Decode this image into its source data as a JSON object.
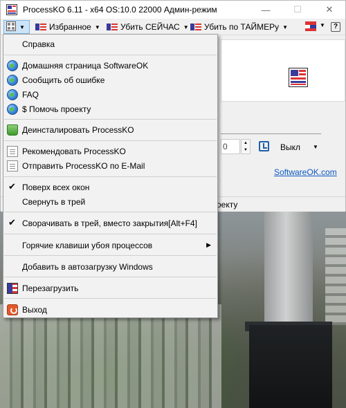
{
  "window": {
    "title": "ProcessKO 6.11 - x64   OS:10.0 22000 Админ-режим",
    "minimize_glyph": "—",
    "maximize_glyph": "☐",
    "close_glyph": "✕"
  },
  "toolbar": {
    "favorites": "Избранное",
    "kill_now": "Убить СЕЙЧАС",
    "kill_timer": "Убить по ТАЙМЕРу",
    "help_glyph": "?",
    "arrow_glyph": "▼"
  },
  "menu": {
    "items": [
      {
        "label": "Справка",
        "icon": "none"
      },
      {
        "label": "Домашняя страница SoftwareOK",
        "icon": "globe-icon"
      },
      {
        "label": "Сообщить об ошибке",
        "icon": "globe-icon"
      },
      {
        "label": "FAQ",
        "icon": "globe-icon"
      },
      {
        "label": "$ Помочь проекту",
        "icon": "globe-icon"
      },
      {
        "label": "Деинсталировать ProcessKO",
        "icon": "recycle-bin-icon"
      },
      {
        "label": "Рекомендовать ProcessKO",
        "icon": "document-icon"
      },
      {
        "label": "Отправить ProcessKO по E-Mail",
        "icon": "document-icon"
      },
      {
        "label": "Поверх всех окон",
        "icon": "check-icon",
        "checked": true
      },
      {
        "label": "Свернуть в трей",
        "icon": "none"
      },
      {
        "label": "Сворачивать в трей, вместо закрытия[Alt+F4]",
        "icon": "check-icon",
        "checked": true
      },
      {
        "label": "Горячие клавиши убоя процессов",
        "icon": "none",
        "submenu": true
      },
      {
        "label": "Добавить в автозагрузку Windows",
        "icon": "none"
      },
      {
        "label": "Перезагрузить",
        "icon": "processko-icon"
      },
      {
        "label": "Выход",
        "icon": "exit-icon"
      }
    ],
    "check_glyph": "✔",
    "submenu_glyph": "▶"
  },
  "content": {
    "number_value": "0",
    "off_label": "Выкл",
    "link_text": "SoftwareOK.com",
    "status_fragment": "оекту"
  }
}
